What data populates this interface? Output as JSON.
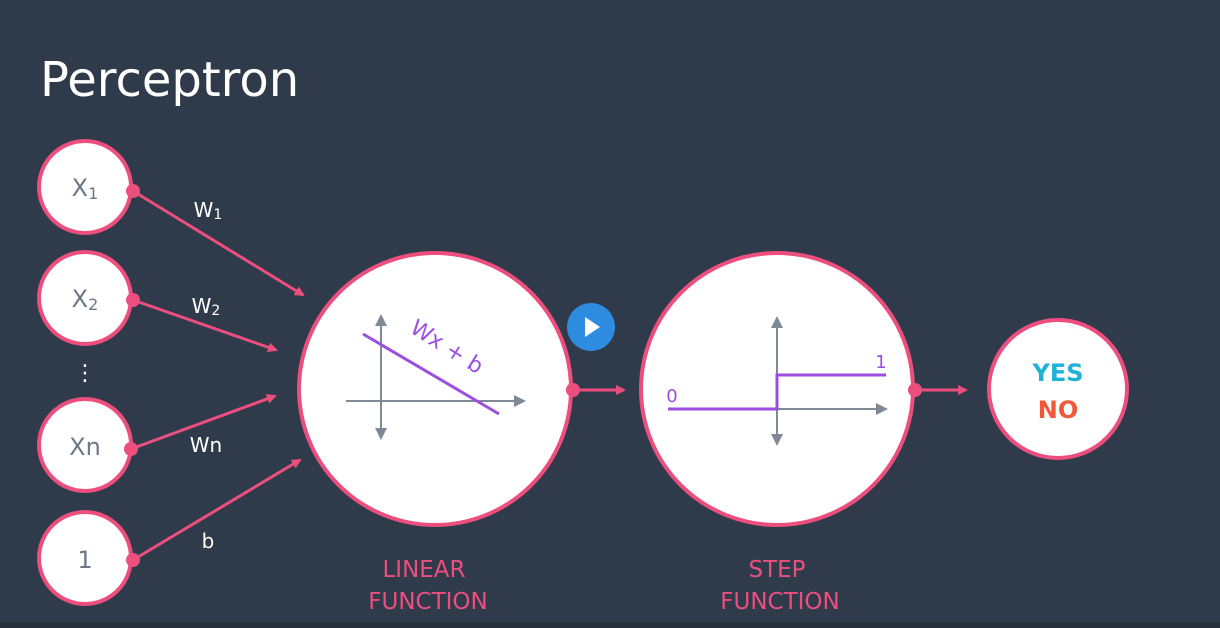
{
  "title": "Perceptron",
  "inputs": [
    {
      "label": "X",
      "sub": "1",
      "weight": "W",
      "weight_sub": "1"
    },
    {
      "label": "X",
      "sub": "2",
      "weight": "W",
      "weight_sub": "2"
    },
    {
      "label": "Xn",
      "sub": "",
      "weight": "Wn",
      "weight_sub": ""
    },
    {
      "label": "1",
      "sub": "",
      "weight": "b",
      "weight_sub": ""
    }
  ],
  "ellipsis": "⋮",
  "linear": {
    "equation": "Wx + b",
    "label_line1": "LINEAR",
    "label_line2": "FUNCTION"
  },
  "step": {
    "low_value": "0",
    "high_value": "1",
    "label_line1": "STEP",
    "label_line2": "FUNCTION"
  },
  "output": {
    "yes": "YES",
    "no": "NO"
  },
  "colors": {
    "background": "#2f3b4a",
    "pink": "#ec4e7e",
    "purple": "#9b4fe0",
    "axis": "#7f8a96",
    "yes": "#1fb2d6",
    "no": "#f05a3a",
    "play": "#2d8be0"
  }
}
